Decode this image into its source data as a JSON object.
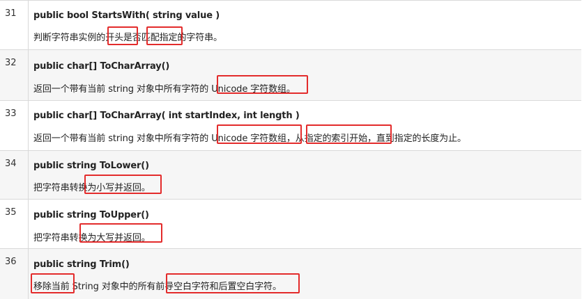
{
  "rows": [
    {
      "num": "31",
      "signature": "public bool StartsWith( string value )",
      "description": "判断字符串实例的开头是否匹配指定的字符串。"
    },
    {
      "num": "32",
      "signature": "public char[] ToCharArray()",
      "description": "返回一个带有当前 string 对象中所有字符的 Unicode 字符数组。"
    },
    {
      "num": "33",
      "signature": "public char[] ToCharArray( int startIndex, int length )",
      "description": "返回一个带有当前 string 对象中所有字符的 Unicode 字符数组，从指定的索引开始，直到指定的长度为止。"
    },
    {
      "num": "34",
      "signature": "public string ToLower()",
      "description": "把字符串转换为小写并返回。"
    },
    {
      "num": "35",
      "signature": "public string ToUpper()",
      "description": "把字符串转换为大写并返回。"
    },
    {
      "num": "36",
      "signature": "public string Trim()",
      "description": "移除当前 String 对象中的所有前导空白字符和后置空白字符。"
    }
  ],
  "colors": {
    "highlight": "#e32b2b",
    "alt_row": "#f6f6f6",
    "border": "#d9d9d9"
  }
}
